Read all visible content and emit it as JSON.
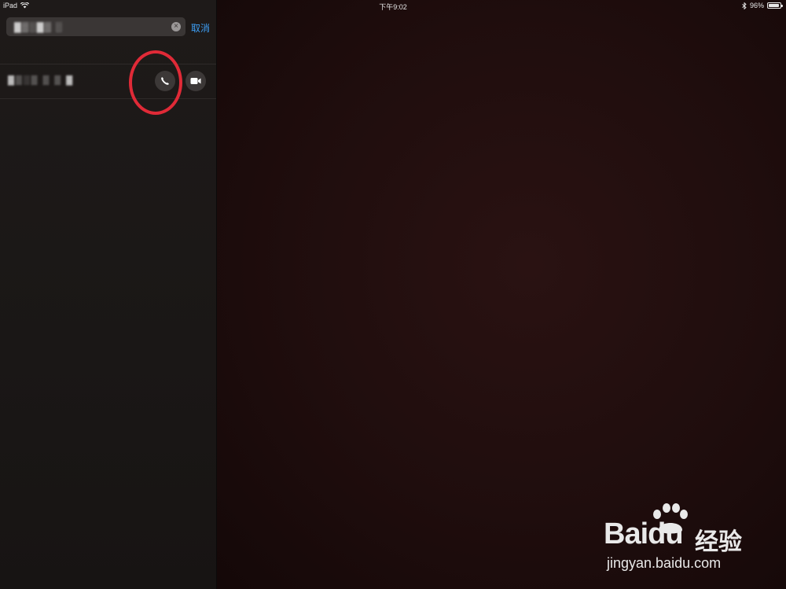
{
  "status_bar": {
    "device": "iPad",
    "time": "下午9:02",
    "battery_text": "96%",
    "battery_level": 0.96
  },
  "search": {
    "value": "▓▒░▓▒ ░",
    "cancel_label": "取消"
  },
  "result": {
    "name": "▓▒░▒ ▒ ▒ ▓"
  },
  "icons": {
    "wifi": "wifi-icon",
    "bluetooth": "bluetooth-icon",
    "battery": "battery-icon",
    "clear": "clear-icon",
    "phone": "phone-icon",
    "video": "video-camera-icon"
  },
  "colors": {
    "accent": "#3d9ff5",
    "highlight": "#e02a37",
    "panel": "#1e1a19",
    "camera_bg": "#1d0f0f"
  },
  "watermark": {
    "logo": "Baidu",
    "cn": "经验",
    "url": "jingyan.baidu.com"
  }
}
